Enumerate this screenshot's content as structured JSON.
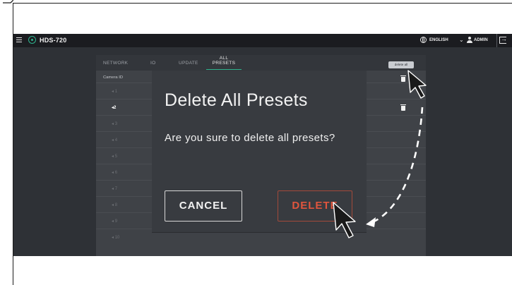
{
  "app": {
    "brand": "HDS-720",
    "language": "ENGLISH",
    "user": "ADMIN"
  },
  "tabs": [
    {
      "label": "NETWORK"
    },
    {
      "label": "IO"
    },
    {
      "label": "UPDATE"
    },
    {
      "label": "ALL PRESETS",
      "line1": "ALL",
      "line2": "PRESETS",
      "active": true
    }
  ],
  "delete_all_label": "delete all",
  "table": {
    "header": "Camera ID",
    "rows": [
      {
        "label": "1"
      },
      {
        "label": "2",
        "highlighted": true
      },
      {
        "label": "3"
      },
      {
        "label": "4"
      },
      {
        "label": "5"
      },
      {
        "label": "6"
      },
      {
        "label": "7"
      },
      {
        "label": "8"
      },
      {
        "label": "9"
      },
      {
        "label": "10"
      }
    ]
  },
  "dialog": {
    "title": "Delete All Presets",
    "message": "Are you sure to delete all presets?",
    "cancel_label": "CANCEL",
    "delete_label": "DELETE"
  },
  "colors": {
    "accent": "#2fb38e",
    "danger": "#e0553d",
    "topbar": "#1b1c20",
    "background": "#2e3136"
  },
  "icons": [
    "menu-icon",
    "logo-icon",
    "globe-icon",
    "chevron-down-icon",
    "user-icon",
    "logout-icon",
    "trash-icon",
    "cursor-icon",
    "dashed-arrow-icon"
  ]
}
